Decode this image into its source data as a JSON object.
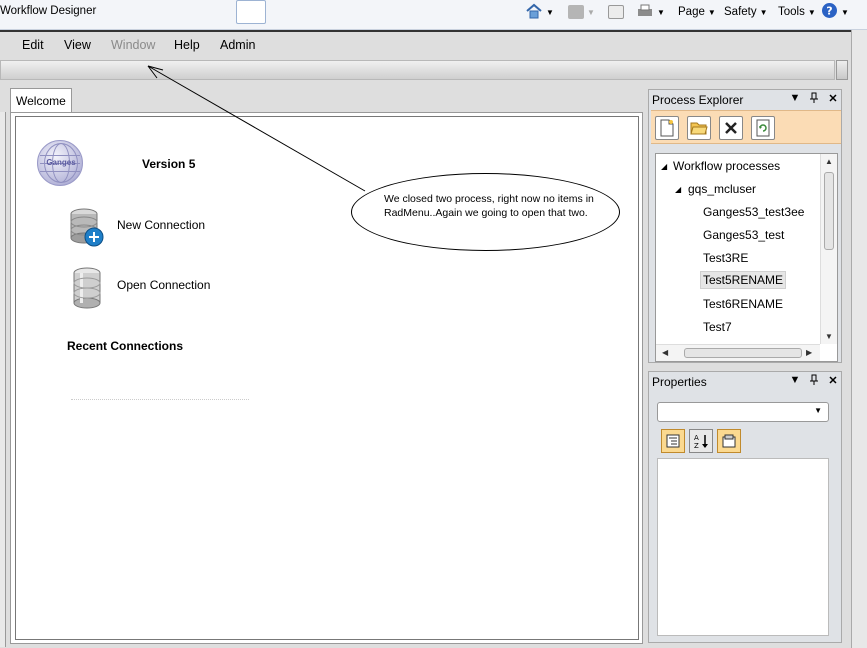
{
  "window_title": "Workflow Designer",
  "ie_commands": {
    "page": "Page",
    "safety": "Safety",
    "tools": "Tools"
  },
  "menu": {
    "items": [
      {
        "label": "Edit",
        "enabled": true
      },
      {
        "label": "View",
        "enabled": true
      },
      {
        "label": "Window",
        "enabled": false
      },
      {
        "label": "Help",
        "enabled": true
      },
      {
        "label": "Admin",
        "enabled": true
      }
    ]
  },
  "tabs": [
    {
      "label": "Welcome",
      "active": true
    }
  ],
  "welcome": {
    "logo_text": "Ganges",
    "version": "Version 5",
    "new_connection": "New Connection",
    "open_connection": "Open Connection",
    "recent_title": "Recent Connections"
  },
  "callout": {
    "text": "We closed two process, right now no items in RadMenu..Again we going to open that two."
  },
  "process_explorer": {
    "title": "Process Explorer",
    "root": "Workflow processes",
    "user": "gqs_mcluser",
    "processes": [
      "Ganges53_test3ee",
      "Ganges53_test",
      "Test3RE",
      "Test5RENAME",
      "Test6RENAME",
      "Test7"
    ],
    "selected": "Test5RENAME"
  },
  "properties": {
    "title": "Properties",
    "combo_value": ""
  },
  "colors": {
    "toolbar_orange": "#fbdcb5",
    "button_gold": "#fbd990",
    "panel_bg": "#dfe2e6"
  }
}
